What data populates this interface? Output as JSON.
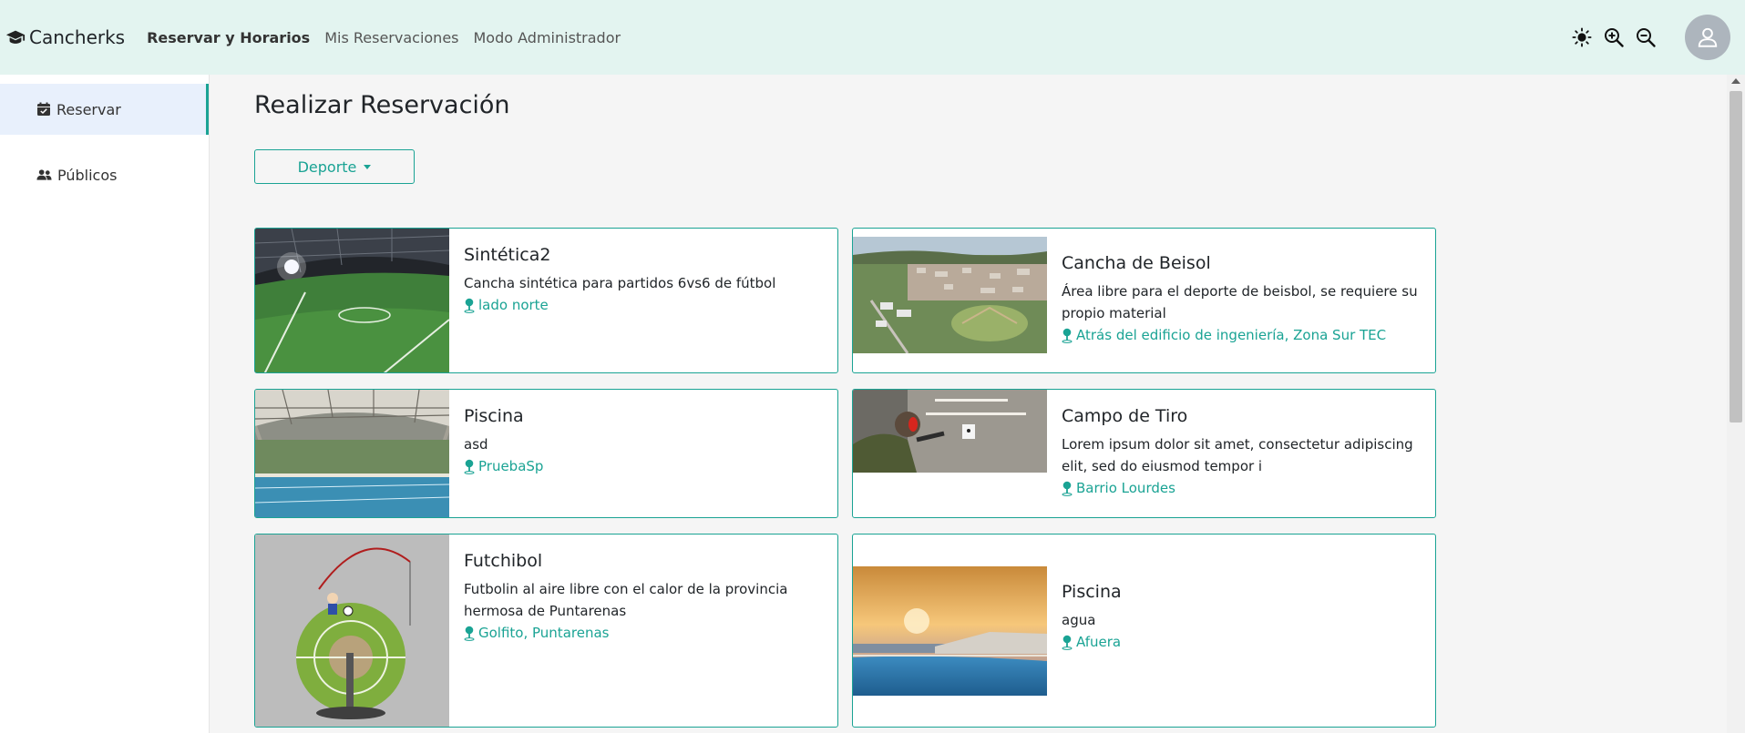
{
  "app": {
    "name": "Cancherks"
  },
  "nav": {
    "links": [
      "Reservar y Horarios",
      "Mis Reservaciones",
      "Modo Administrador"
    ]
  },
  "sidebar": {
    "items": [
      {
        "label": "Reservar",
        "icon": "calendar-check-icon",
        "active": true
      },
      {
        "label": "Públicos",
        "icon": "users-icon",
        "active": false
      }
    ]
  },
  "main": {
    "title": "Realizar Reservación",
    "filter_label": "Deporte"
  },
  "cards": [
    {
      "title": "Sintética2",
      "description": "Cancha sintética para partidos 6vs6 de fútbol",
      "location": "lado norte",
      "image": "synthetic-field-photo"
    },
    {
      "title": "Cancha de Beisol",
      "description": "Área libre para el deporte de beisbol, se requiere su propio material",
      "location": "Atrás del edificio de ingeniería, Zona Sur TEC",
      "image": "aerial-campus-photo"
    },
    {
      "title": "Piscina",
      "description": "asd",
      "location": "PruebaSp",
      "image": "indoor-pool-photo"
    },
    {
      "title": "Campo de Tiro",
      "description": "Lorem ipsum dolor sit amet, consectetur adipiscing elit, sed do eiusmod tempor i",
      "location": "Barrio Lourdes",
      "image": "shooting-range-photo"
    },
    {
      "title": "Futchibol",
      "description": "Futbolin al aire libre con el calor de la provincia hermosa de Puntarenas",
      "location": "Golfito, Puntarenas",
      "image": "soccer-cartoon-photo"
    },
    {
      "title": "Piscina",
      "description": "agua",
      "location": "Afuera",
      "image": "infinity-pool-sunset-photo"
    }
  ],
  "theme": {
    "accent": "#1aa394",
    "navbar_bg": "#e3f4f0",
    "active_bg": "#e8f0fc"
  }
}
